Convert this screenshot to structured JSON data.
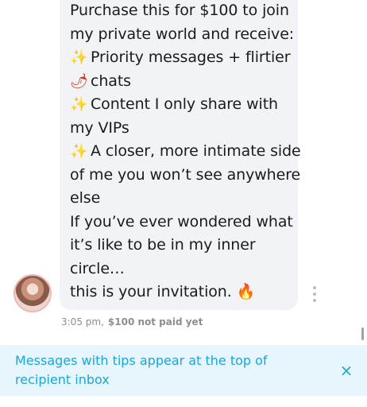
{
  "message": {
    "lines": [
      {
        "emoji": "",
        "text": "Purchase this for $100 to join"
      },
      {
        "emoji": "",
        "text": "my private world and receive:"
      },
      {
        "emoji": "✨",
        "text": "Priority messages + flirtier"
      },
      {
        "emoji": "🌶",
        "text": "chats"
      },
      {
        "emoji": "✨",
        "text": "Content I only share with"
      },
      {
        "emoji": "",
        "text": "my VIPs"
      },
      {
        "emoji": "✨",
        "text": "A closer, more intimate side"
      },
      {
        "emoji": "",
        "text": "of me you won’t see anywhere"
      },
      {
        "emoji": "",
        "text": "else"
      },
      {
        "emoji": "",
        "text": "If you’ve ever wondered what"
      },
      {
        "emoji": "",
        "text": "it’s like to be in my inner"
      },
      {
        "emoji": "",
        "text": "circle…"
      },
      {
        "emoji": "",
        "text": "this is your invitation."
      }
    ],
    "trailing_emoji": "🔥",
    "time": "3:05 pm,",
    "price_status": "$100 not paid yet"
  },
  "banner": {
    "text": "Messages with tips appear at the top of recipient inbox",
    "close_icon": "×"
  },
  "colors": {
    "bubble": "#f2f3f6",
    "banner_bg": "#e6f6fc",
    "accent": "#1aa6d6"
  },
  "icons": {
    "avatar": "avatar",
    "more": "more-vertical-icon",
    "close": "close-icon"
  }
}
